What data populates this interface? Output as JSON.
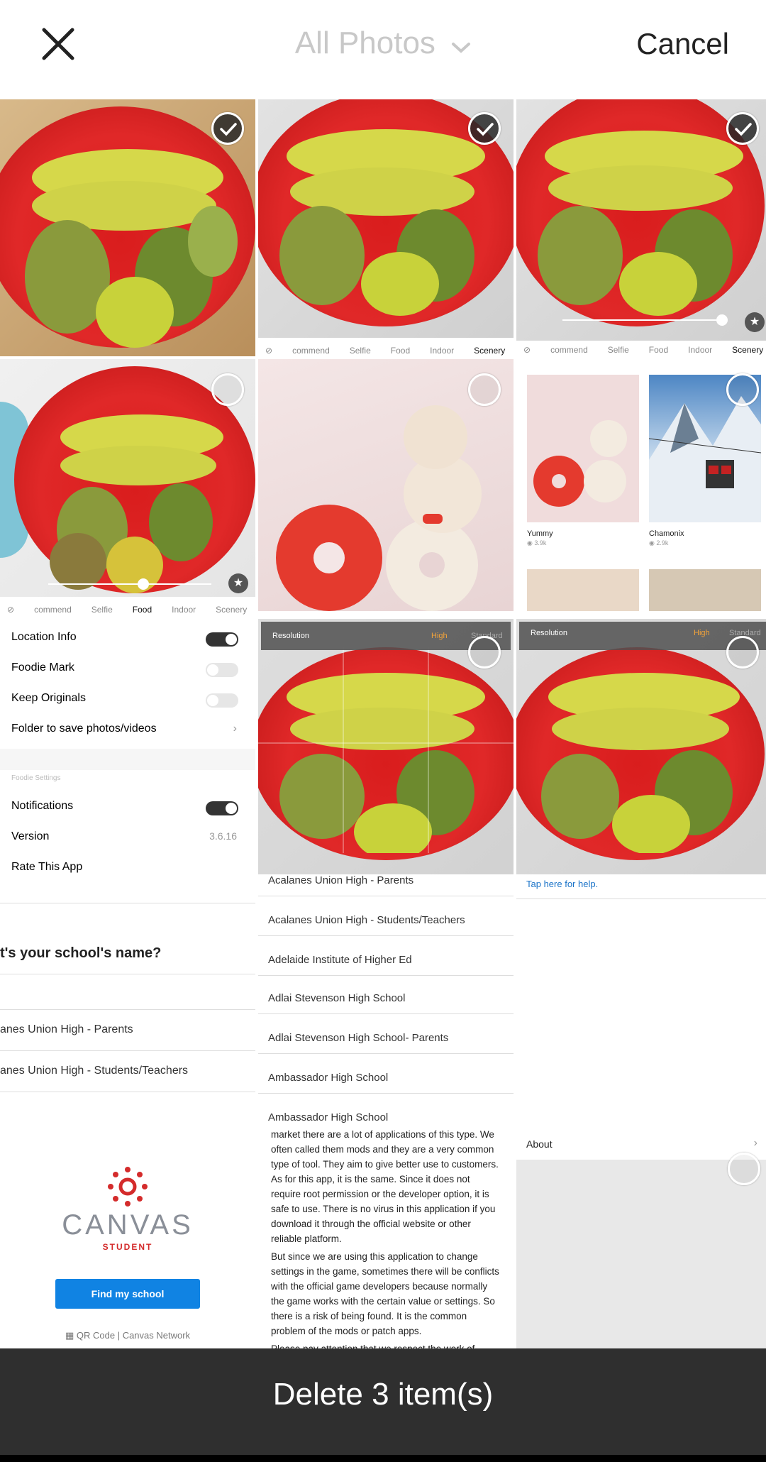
{
  "header": {
    "album_label": "All Photos",
    "cancel_label": "Cancel"
  },
  "filter_bar": {
    "items": [
      "commend",
      "Selfie",
      "Food",
      "Indoor",
      "Scenery"
    ],
    "selected_scenery": "Scenery",
    "selected_food": "Food"
  },
  "feed": {
    "item1_title": "Yummy",
    "item1_views": "3.9k",
    "item2_title": "Chamonix",
    "item2_views": "2.9k"
  },
  "resolution": {
    "label": "Resolution",
    "high": "High",
    "standard": "Standard"
  },
  "settings": {
    "location_info": "Location Info",
    "foodie_mark": "Foodie Mark",
    "keep_originals": "Keep Originals",
    "folder": "Folder to save photos/videos",
    "section": "Foodie Settings",
    "notifications": "Notifications",
    "version_label": "Version",
    "version_value": "3.6.16",
    "rate": "Rate This App",
    "about": "About"
  },
  "school": {
    "question": "t's your school's name?",
    "left_items": [
      "anes Union High - Parents",
      "anes Union High - Students/Teachers"
    ],
    "list": [
      "Acalanes Union High - Parents",
      "Acalanes Union High - Students/Teachers",
      "Adelaide Institute of Higher Ed",
      "Adlai Stevenson High School",
      "Adlai Stevenson High School- Parents",
      "Ambassador High School",
      "Ambassador High School"
    ],
    "help_link": "Tap here for help.",
    "brand": "CANVAS",
    "brand_sub": "STUDENT",
    "find_button": "Find my school",
    "qr_label": "QR Code",
    "network_label": "Canvas Network"
  },
  "article": {
    "p1": "market there are a lot of applications of this type. We often called them mods and they are a very common type of tool. They aim to give better use to customers. As for this app, it is the same. Since it does not require root permission or the developer option, it is safe to use. There is no virus in this application if you download it through the official website or other reliable platform.",
    "p2": "But since we are using this application to change settings in the game, sometimes there will be conflicts with the official game developers because normally the game works with the certain value or settings. So there is a risk of being found. It is the common problem of the mods or patch apps.",
    "p3": "Please pay attention that we respect the work of"
  },
  "actions": {
    "delete_label": "Delete 3 item(s)"
  },
  "colors": {
    "accent_orange": "#f2a33a",
    "link_blue": "#1a73c8",
    "canvas_red": "#d42b2b",
    "button_blue": "#1083e3"
  }
}
